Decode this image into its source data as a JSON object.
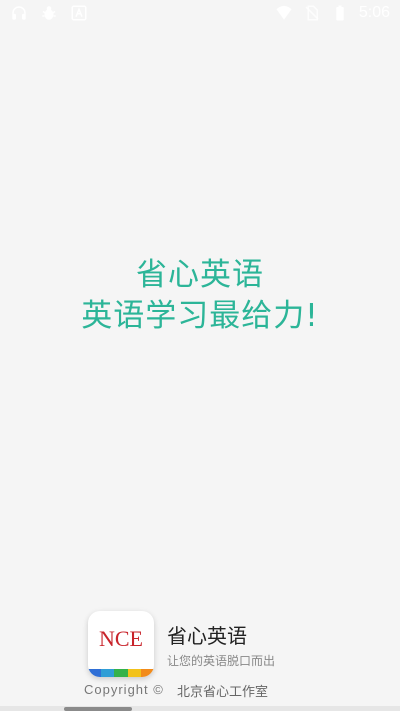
{
  "status_bar": {
    "time": "5:06",
    "left_icons": [
      "headset-icon",
      "bug-icon",
      "text-a-icon"
    ],
    "right_icons": [
      "wifi-icon",
      "no-sim-icon",
      "battery-icon"
    ]
  },
  "splash": {
    "line1": "省心英语",
    "line2": "英语学习最给力!",
    "accent_color": "#2cb598"
  },
  "footer": {
    "logo_text": "NCE",
    "app_name": "省心英语",
    "tagline": "让您的英语脱口而出",
    "copyright": "Copyright ©",
    "studio": "北京省心工作室"
  }
}
